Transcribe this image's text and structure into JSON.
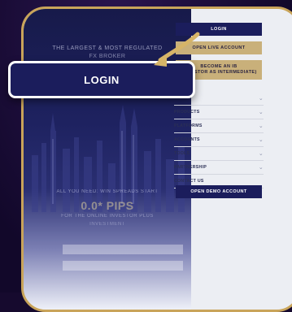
{
  "hero": {
    "line1": "THE LARGEST & MOST REGULATED",
    "line2": "FX BROKER",
    "line3": "ALL YOU NEED: WIN SPREADS START",
    "line4": "0.0* PIPS",
    "line5": "FOR THE ONLINE INVESTOR PLUS",
    "line6": "INVESTMENT"
  },
  "header_buttons": {
    "login": "LOGIN",
    "open_live": "OPEN LIVE ACCOUNT",
    "ib_line1": "BECOME AN IB",
    "ib_line2": "(INVESTOR AS INTERMEDIATE)"
  },
  "menu": {
    "items": [
      {
        "label": "",
        "chevron": "⌄"
      },
      {
        "label": "PRODUCTS",
        "chevron": "⌄"
      },
      {
        "label": "PLATFORMS",
        "chevron": "⌄"
      },
      {
        "label": "ACCOUNTS",
        "chevron": "⌄"
      },
      {
        "label": "TOOLS",
        "chevron": "⌄"
      },
      {
        "label": "PARTNERSHIP",
        "chevron": "⌄"
      },
      {
        "label": "CONTACT US",
        "chevron": ""
      }
    ]
  },
  "demo_button": "OPEN DEMO ACCOUNT",
  "callout": {
    "label": "LOGIN"
  },
  "colors": {
    "navy": "#1b1d5c",
    "gold": "#c9b07a",
    "frame_gold": "#c9a45a",
    "arrow": "#d6b468"
  },
  "icons": {
    "arrow": "curved-arrow-icon",
    "chevron": "chevron-down-icon"
  }
}
